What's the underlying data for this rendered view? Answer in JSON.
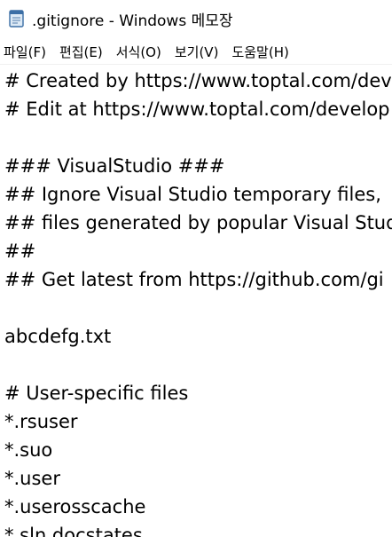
{
  "window": {
    "title": ".gitignore - Windows 메모장",
    "icon": "notepad-icon"
  },
  "menu": {
    "items": [
      {
        "label": "파일(F)"
      },
      {
        "label": "편집(E)"
      },
      {
        "label": "서식(O)"
      },
      {
        "label": "보기(V)"
      },
      {
        "label": "도움말(H)"
      }
    ]
  },
  "editor": {
    "lines": [
      "# Created by https://www.toptal.com/dev",
      "# Edit at https://www.toptal.com/develop",
      "",
      "### VisualStudio ###",
      "## Ignore Visual Studio temporary files,",
      "## files generated by popular Visual Stud",
      "##",
      "## Get latest from https://github.com/gi",
      "",
      "abcdefg.txt",
      "",
      "# User-specific files",
      "*.rsuser",
      "*.suo",
      "*.user",
      "*.userosscache",
      "*.sln.docstates"
    ]
  },
  "colors": {
    "background": "#ffffff",
    "text": "#000000",
    "icon_body": "#dce9f5",
    "icon_accent": "#3b6ea5"
  }
}
